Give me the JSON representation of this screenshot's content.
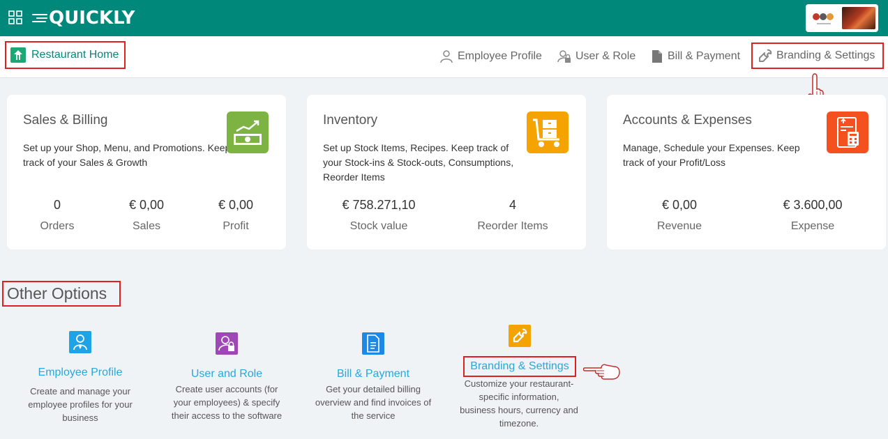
{
  "topbar": {
    "brand": "QUICKLY",
    "colors": {
      "primary": "#00897b",
      "highlight": "#e01f1f",
      "link": "#29a7dc"
    },
    "icons": [
      "apps-grid-icon",
      "restaurant-logo",
      "user-photo"
    ]
  },
  "nav": {
    "home_label": "Restaurant Home",
    "items": [
      {
        "label": "Employee Profile",
        "icon": "person-icon"
      },
      {
        "label": "User & Role",
        "icon": "user-lock-icon"
      },
      {
        "label": "Bill & Payment",
        "icon": "document-icon"
      },
      {
        "label": "Branding & Settings",
        "icon": "wrench-icon"
      }
    ]
  },
  "cards": [
    {
      "title": "Sales & Billing",
      "description": "Set up your Shop, Menu, and Promotions. Keep track of your Sales & Growth",
      "icon": "cash-growth-icon",
      "icon_color": "#7cb342",
      "stats": [
        {
          "value": "0",
          "label": "Orders"
        },
        {
          "value": "€ 0,00",
          "label": "Sales"
        },
        {
          "value": "€ 0,00",
          "label": "Profit"
        }
      ]
    },
    {
      "title": "Inventory",
      "description": "Set up Stock Items, Recipes. Keep track of your Stock-ins & Stock-outs, Consumptions, Reorder Items",
      "icon": "cart-boxes-icon",
      "icon_color": "#f5a300",
      "stats": [
        {
          "value": "€ 758.271,10",
          "label": "Stock value"
        },
        {
          "value": "4",
          "label": "Reorder Items"
        }
      ]
    },
    {
      "title": "Accounts & Expenses",
      "description": "Manage, Schedule your Expenses. Keep track of your Profit/Loss",
      "icon": "ledger-icon",
      "icon_color": "#f4511e",
      "stats": [
        {
          "value": "€ 0,00",
          "label": "Revenue"
        },
        {
          "value": "€ 3.600,00",
          "label": "Expense"
        }
      ]
    }
  ],
  "other": {
    "title": "Other Options",
    "options": [
      {
        "title": "Employee Profile",
        "desc_lines": [
          "Create and manage your",
          "employee profiles for your",
          "business"
        ],
        "icon": "person-icon",
        "icon_color": "#1ea3e6"
      },
      {
        "title": "User and Role",
        "desc_lines": [
          "Create user accounts (for",
          "your employees) & specify",
          "their access to the software"
        ],
        "icon": "user-lock-icon",
        "icon_color": "#a047b8"
      },
      {
        "title": "Bill & Payment",
        "desc_lines": [
          "Get your detailed billing",
          "overview and find invoices of",
          "the service"
        ],
        "icon": "document-icon",
        "icon_color": "#1e88e5"
      },
      {
        "title": "Branding & Settings",
        "desc_lines": [
          "Customize your restaurant-",
          "specific information,",
          "business hours, currency and",
          "timezone."
        ],
        "icon": "wrench-icon",
        "icon_color": "#f5a300"
      }
    ]
  }
}
